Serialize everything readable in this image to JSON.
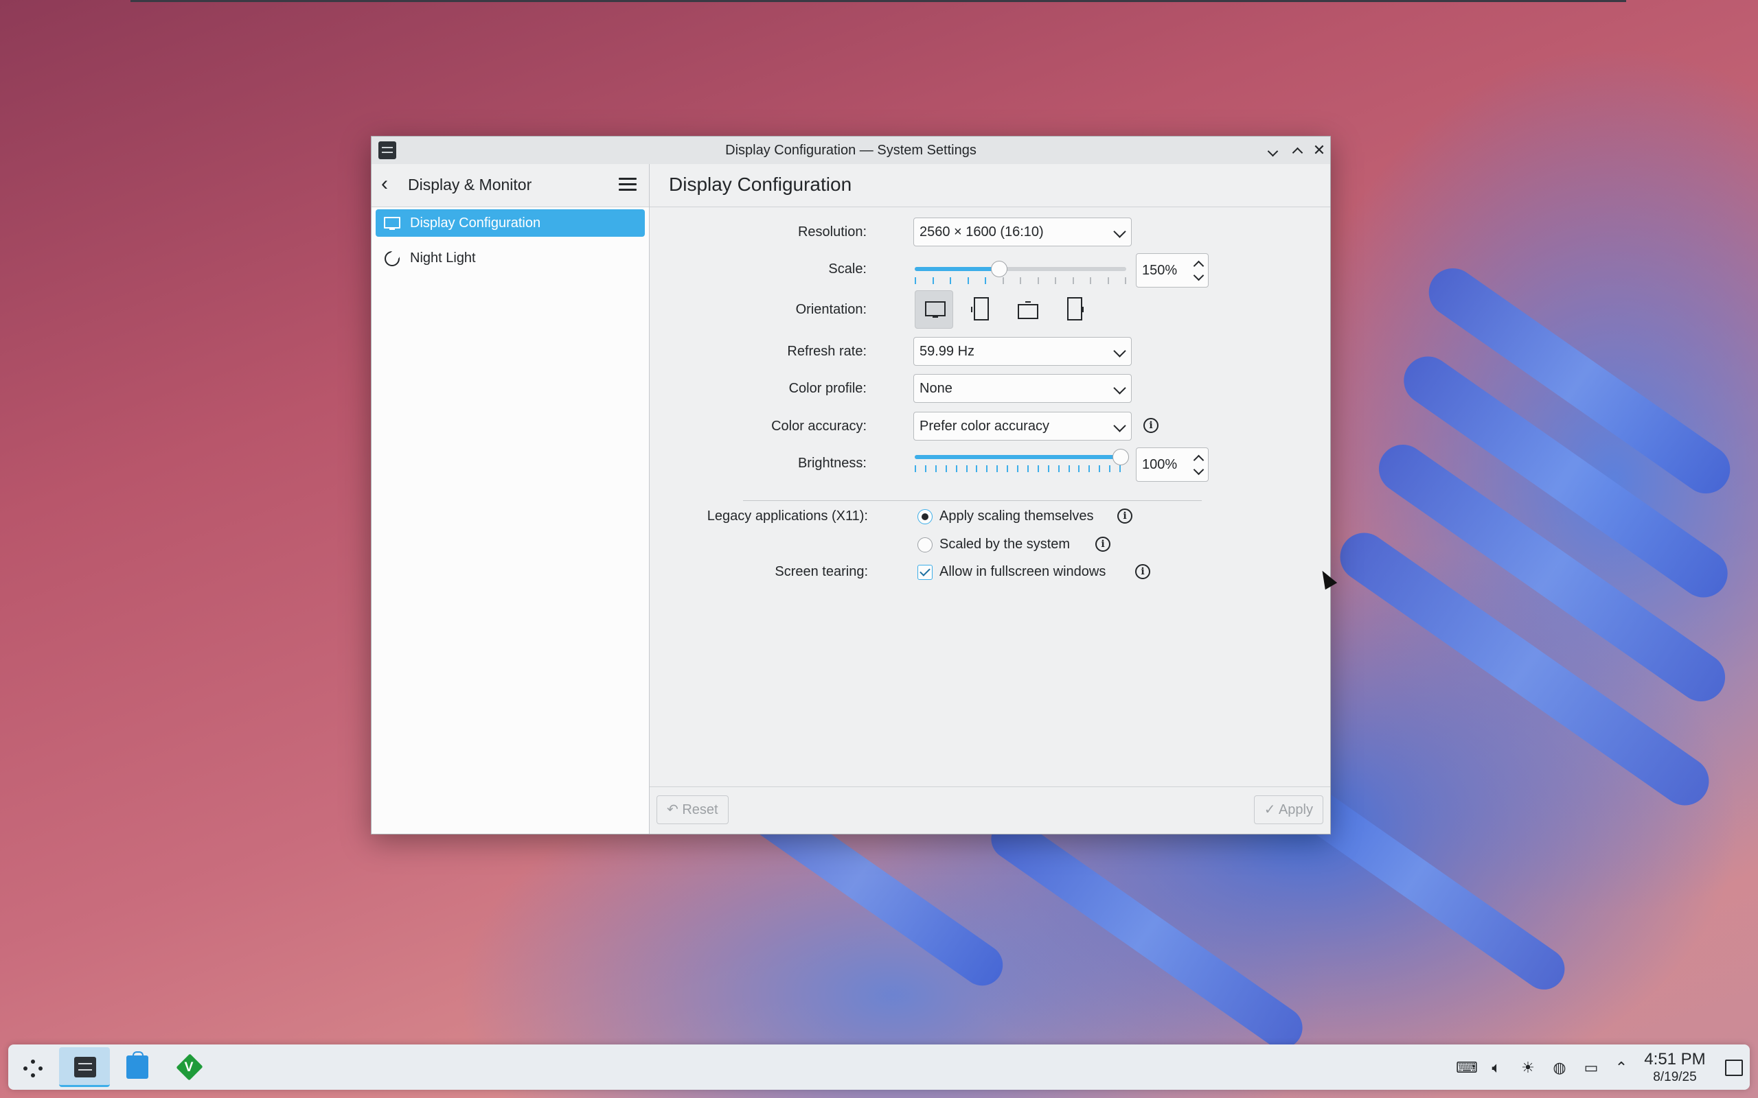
{
  "window": {
    "title": "Display Configuration — System Settings"
  },
  "sidebar": {
    "title": "Display & Monitor",
    "items": [
      {
        "label": "Display Configuration",
        "active": true,
        "icon": "monitor-icon"
      },
      {
        "label": "Night Light",
        "active": false,
        "icon": "night-light-icon"
      }
    ]
  },
  "content": {
    "title": "Display Configuration",
    "resolution": {
      "label": "Resolution:",
      "value": "2560 × 1600 (16:10)"
    },
    "scale": {
      "label": "Scale:",
      "value": "150%",
      "level": 0.4
    },
    "orientation": {
      "label": "Orientation:",
      "options": [
        "landscape",
        "portrait-left",
        "landscape-flipped",
        "portrait-right"
      ],
      "selected": "landscape"
    },
    "refresh_rate": {
      "label": "Refresh rate:",
      "value": "59.99 Hz"
    },
    "color_profile": {
      "label": "Color profile:",
      "value": "None"
    },
    "color_accuracy": {
      "label": "Color accuracy:",
      "value": "Prefer color accuracy"
    },
    "brightness": {
      "label": "Brightness:",
      "value": "100%",
      "level": 1.0
    },
    "legacy": {
      "label": "Legacy applications (X11):",
      "options": [
        {
          "label": "Apply scaling themselves",
          "checked": true
        },
        {
          "label": "Scaled by the system",
          "checked": false
        }
      ]
    },
    "tearing": {
      "label": "Screen tearing:",
      "option": "Allow in fullscreen windows",
      "checked": true
    }
  },
  "footer": {
    "reset_label": "Reset",
    "apply_label": "Apply"
  },
  "taskbar": {
    "clock_time": "4:51 PM",
    "clock_date": "8/19/25",
    "apps": [
      "application-launcher",
      "system-settings",
      "discover-store",
      "gvim"
    ],
    "tray_icons": [
      "keyboard-icon",
      "volume-icon",
      "brightness-icon",
      "network-icon",
      "display-icon",
      "expand-tray-icon"
    ]
  },
  "colors": {
    "accent": "#3daee9",
    "window_bg": "#eff0f1",
    "panel_bg": "#e9edf1"
  }
}
